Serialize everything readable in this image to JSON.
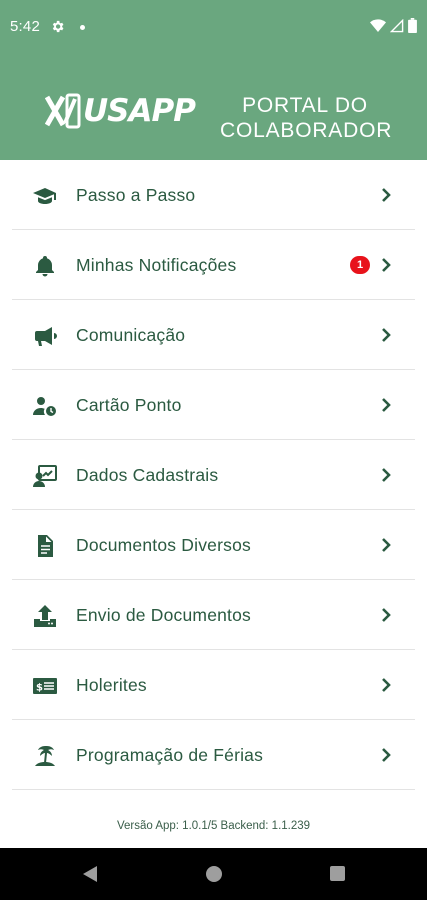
{
  "status": {
    "time": "5:42"
  },
  "header": {
    "logo_text": "USAPP",
    "portal_title_line1": "PORTAL DO",
    "portal_title_line2": "COLABORADOR"
  },
  "menu": {
    "items": [
      {
        "label": "Passo a Passo",
        "icon": "graduation-cap-icon"
      },
      {
        "label": "Minhas Notificações",
        "icon": "bell-icon",
        "badge": "1"
      },
      {
        "label": "Comunicação",
        "icon": "megaphone-icon"
      },
      {
        "label": "Cartão Ponto",
        "icon": "user-clock-icon"
      },
      {
        "label": "Dados Cadastrais",
        "icon": "user-chart-icon"
      },
      {
        "label": "Documentos Diversos",
        "icon": "document-icon"
      },
      {
        "label": "Envio de Documentos",
        "icon": "upload-icon"
      },
      {
        "label": "Holerites",
        "icon": "money-bill-icon"
      },
      {
        "label": "Programação de Férias",
        "icon": "palm-tree-icon"
      }
    ]
  },
  "footer": {
    "version": "Versão App: 1.0.1/5 Backend: 1.1.239"
  },
  "colors": {
    "header": "#6aa77f",
    "primary": "#2b5a41",
    "badge": "#e8131b"
  }
}
